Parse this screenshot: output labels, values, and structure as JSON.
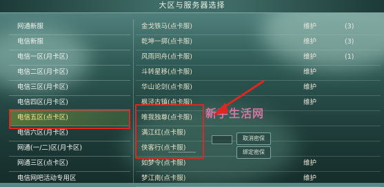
{
  "window": {
    "title": "大区与服务器选择"
  },
  "regions": [
    {
      "label": "网通新服"
    },
    {
      "label": "电信新服"
    },
    {
      "label": "电信一区(月卡区)"
    },
    {
      "label": "电信二区(月卡区)"
    },
    {
      "label": "电信三区(月卡区)"
    },
    {
      "label": "电信四区(月卡区)"
    },
    {
      "label": "电信五区(点卡区)",
      "selected": true
    },
    {
      "label": "电信六区(月卡区)"
    },
    {
      "label": "网通(一/二)区(月卡区)"
    },
    {
      "label": "网通三区(点卡区)"
    },
    {
      "label": "电信网吧活动专用区"
    }
  ],
  "servers": [
    {
      "name": "金戈铁马(点卡服)",
      "status": "维护",
      "count": "(3)"
    },
    {
      "name": "乾坤一掷(点卡服)",
      "status": "维护",
      "count": "(3)"
    },
    {
      "name": "风雨同舟(点卡服)",
      "status": "维护",
      "count": "(1)"
    },
    {
      "name": "斗转星移(点卡服)",
      "status": "维护",
      "count": ""
    },
    {
      "name": "华山论剑(点卡服)",
      "status": "维护",
      "count": ""
    },
    {
      "name": "枫泾古镇(点卡服)",
      "status": "维护",
      "count": ""
    },
    {
      "name": "唯我独尊(点卡服)",
      "status": "",
      "count": ""
    },
    {
      "name": "满江红(点卡服)",
      "status": "",
      "count": ""
    },
    {
      "name": "侠客行(点卡服)",
      "status": "",
      "count": ""
    },
    {
      "name": "如梦令(点卡服)",
      "status": "维护",
      "count": ""
    },
    {
      "name": "梦江南(点卡服)",
      "status": "维护",
      "count": ""
    }
  ],
  "buttons": {
    "cancel_password": "取消密保",
    "bind_password": "绑定密保"
  },
  "watermark": "新手生活网",
  "colors": {
    "highlight_box": "#e0261e",
    "selected_text": "#ffe98a",
    "watermark": "#f07ab0"
  }
}
